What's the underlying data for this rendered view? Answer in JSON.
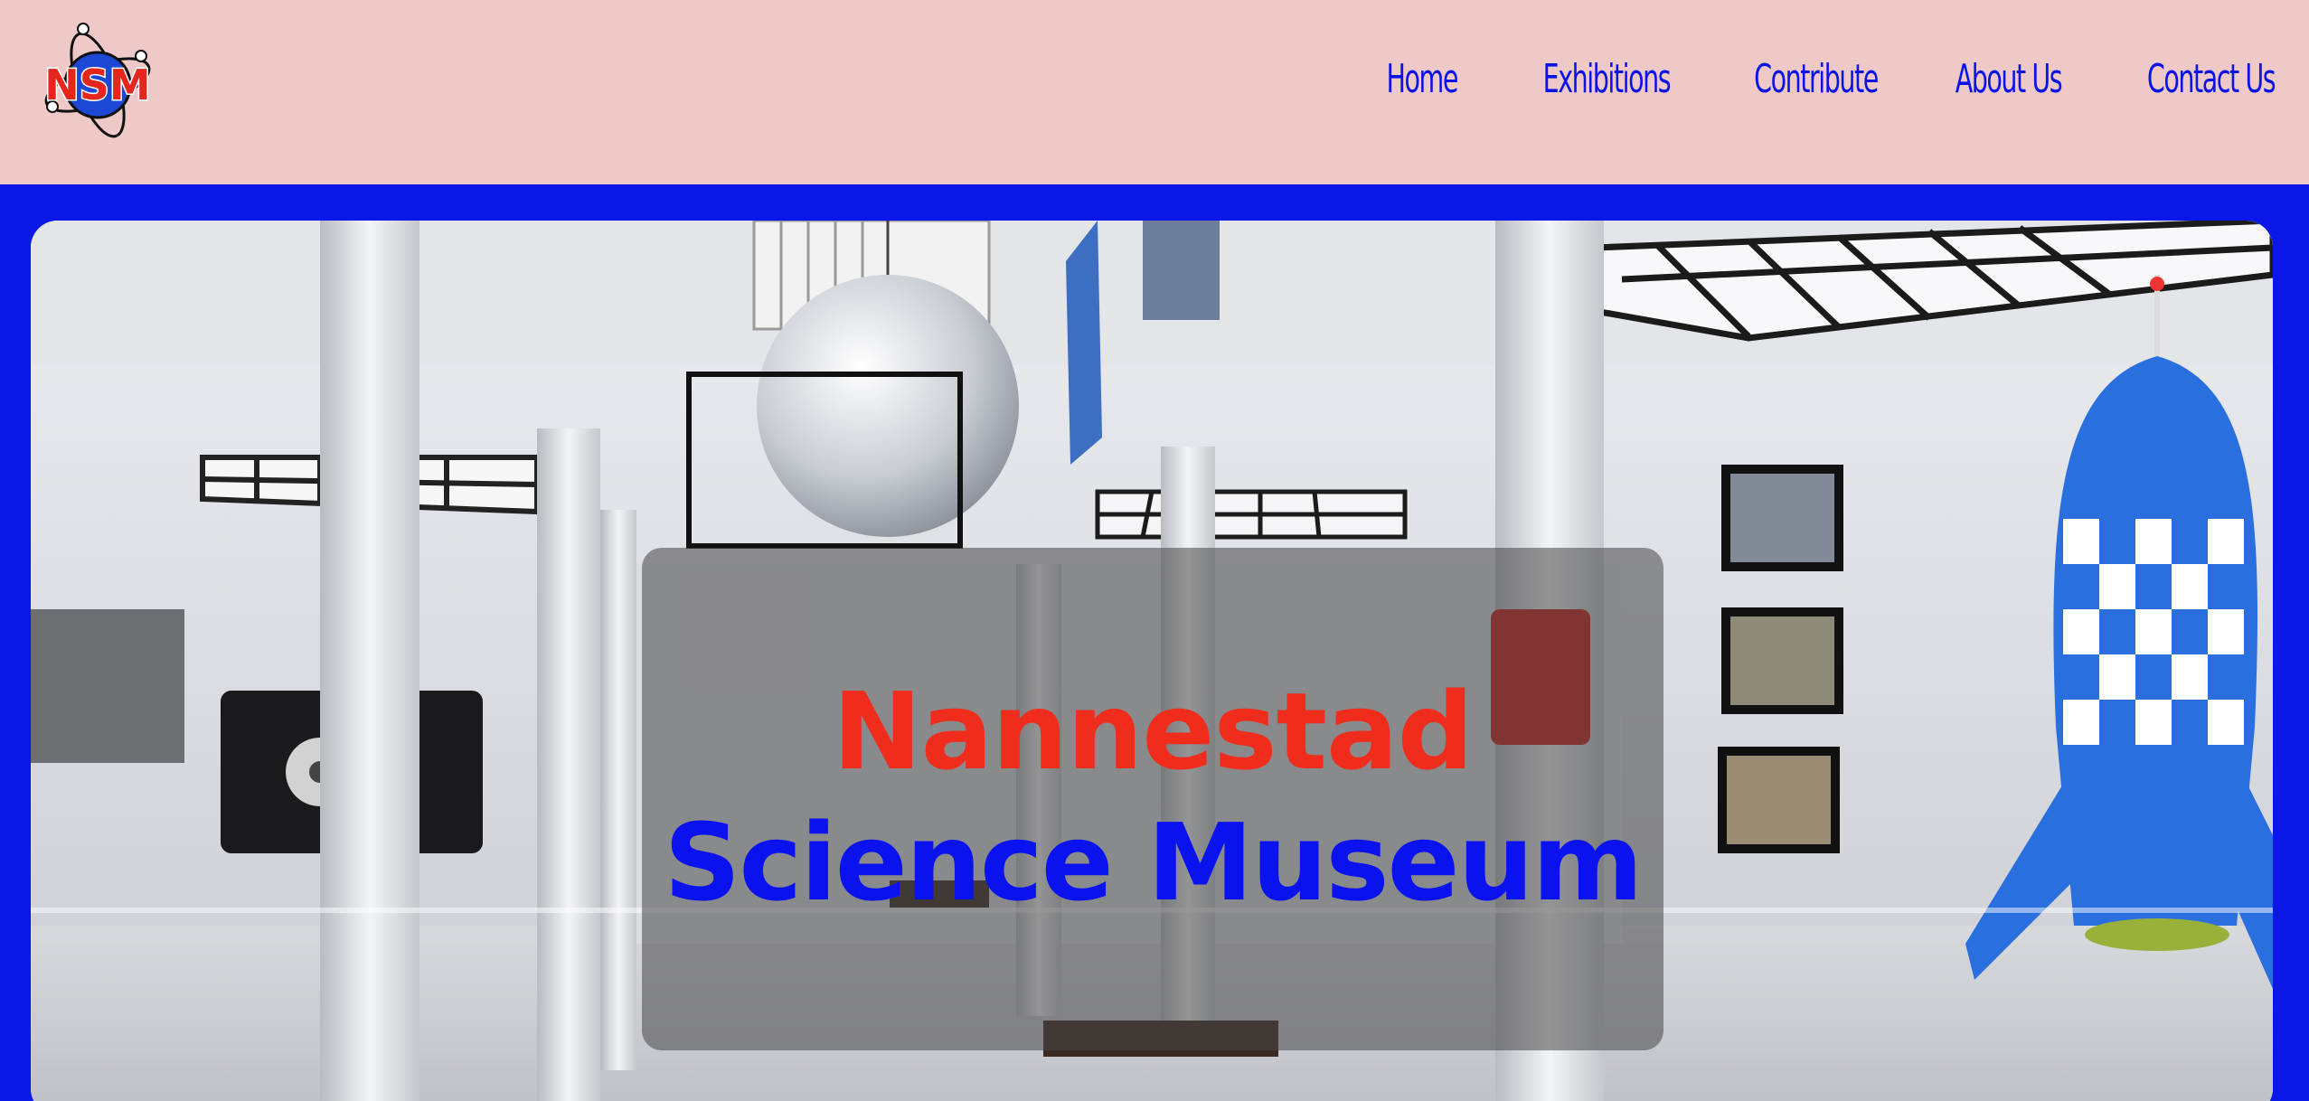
{
  "header": {
    "logo_text": "NSM",
    "nav": [
      "Home",
      "Exhibitions",
      "Contribute",
      "About Us",
      "Contact Us"
    ]
  },
  "hero": {
    "title_line1": "Nannestad",
    "title_line2": "Science Museum",
    "title_line1_color": "#f02c1c",
    "title_line2_color": "#0a12f0"
  },
  "colors": {
    "header_bg": "#efc9c8",
    "page_bg": "#0a17e6",
    "nav_text": "#0b14e6"
  },
  "icons": [
    "atom-logo-icon"
  ]
}
